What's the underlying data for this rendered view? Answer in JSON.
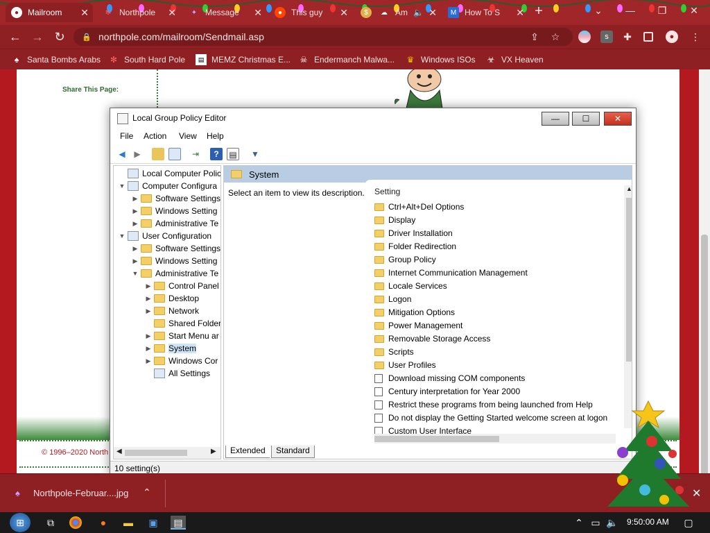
{
  "browser": {
    "tabs": [
      {
        "label": "Mailroom",
        "icon": "chrome-icon",
        "active": true
      },
      {
        "label": "Northpole",
        "icon": "snowflake-icon"
      },
      {
        "label": "Message",
        "icon": "star-icon"
      },
      {
        "label": "This guy",
        "icon": "reddit-icon"
      },
      {
        "label": "",
        "icon": "s-icon"
      },
      {
        "label": "Am",
        "icon": "cloud-icon"
      },
      {
        "label": "How To S",
        "icon": "m-icon"
      }
    ],
    "address": "northpole.com/mailroom/Sendmail.asp",
    "bookmarks": [
      "Santa Bombs Arabs",
      "South Hard Pole",
      "MEMZ Christmas E...",
      "Endermanch Malwa...",
      "Windows ISOs",
      "VX Heaven"
    ]
  },
  "page": {
    "share_label": "Share This Page:",
    "copyright": "© 1996–2020 North"
  },
  "dialog": {
    "title": "Local Group Policy Editor",
    "window_buttons": {
      "minimize": "—",
      "maximize": "☐",
      "close": "✕"
    },
    "menu": [
      "File",
      "Action",
      "View",
      "Help"
    ],
    "tree": [
      {
        "label": "Local Computer Policy",
        "indent": 0,
        "arrow": "",
        "icon": "policy"
      },
      {
        "label": "Computer Configura",
        "indent": 0,
        "arrow": "down",
        "icon": "computer"
      },
      {
        "label": "Software Settings",
        "indent": 1,
        "arrow": "right",
        "icon": "folder"
      },
      {
        "label": "Windows Setting",
        "indent": 1,
        "arrow": "right",
        "icon": "folder"
      },
      {
        "label": "Administrative Te",
        "indent": 1,
        "arrow": "right",
        "icon": "folder"
      },
      {
        "label": "User Configuration",
        "indent": 0,
        "arrow": "down",
        "icon": "user"
      },
      {
        "label": "Software Settings",
        "indent": 1,
        "arrow": "right",
        "icon": "folder"
      },
      {
        "label": "Windows Setting",
        "indent": 1,
        "arrow": "right",
        "icon": "folder"
      },
      {
        "label": "Administrative Te",
        "indent": 1,
        "arrow": "down",
        "icon": "folder"
      },
      {
        "label": "Control Panel",
        "indent": 2,
        "arrow": "right",
        "icon": "folder"
      },
      {
        "label": "Desktop",
        "indent": 2,
        "arrow": "right",
        "icon": "folder"
      },
      {
        "label": "Network",
        "indent": 2,
        "arrow": "right",
        "icon": "folder"
      },
      {
        "label": "Shared Folder",
        "indent": 2,
        "arrow": "",
        "icon": "folder"
      },
      {
        "label": "Start Menu ar",
        "indent": 2,
        "arrow": "right",
        "icon": "folder"
      },
      {
        "label": "System",
        "indent": 2,
        "arrow": "right",
        "icon": "folder",
        "selected": true
      },
      {
        "label": "Windows Cor",
        "indent": 2,
        "arrow": "right",
        "icon": "folder"
      },
      {
        "label": "All Settings",
        "indent": 2,
        "arrow": "",
        "icon": "settings"
      }
    ],
    "pane_title": "System",
    "description": "Select an item to view its description.",
    "list_header": "Setting",
    "settings": [
      {
        "label": "Ctrl+Alt+Del Options",
        "type": "folder"
      },
      {
        "label": "Display",
        "type": "folder"
      },
      {
        "label": "Driver Installation",
        "type": "folder"
      },
      {
        "label": "Folder Redirection",
        "type": "folder"
      },
      {
        "label": "Group Policy",
        "type": "folder"
      },
      {
        "label": "Internet Communication Management",
        "type": "folder"
      },
      {
        "label": "Locale Services",
        "type": "folder"
      },
      {
        "label": "Logon",
        "type": "folder"
      },
      {
        "label": "Mitigation Options",
        "type": "folder"
      },
      {
        "label": "Power Management",
        "type": "folder"
      },
      {
        "label": "Removable Storage Access",
        "type": "folder"
      },
      {
        "label": "Scripts",
        "type": "folder"
      },
      {
        "label": "User Profiles",
        "type": "folder"
      },
      {
        "label": "Download missing COM components",
        "type": "policy"
      },
      {
        "label": "Century interpretation for Year 2000",
        "type": "policy"
      },
      {
        "label": "Restrict these programs from being launched from Help",
        "type": "policy"
      },
      {
        "label": "Do not display the Getting Started welcome screen at logon",
        "type": "policy"
      },
      {
        "label": "Custom User Interface",
        "type": "policy"
      }
    ],
    "view_tabs": [
      "Extended",
      "Standard"
    ],
    "status": "10 setting(s)"
  },
  "download": {
    "file": "Northpole-Februar....jpg"
  },
  "taskbar": {
    "clock": "9:50:00 AM"
  },
  "colors": {
    "chrome_red": "#8e1f22",
    "page_red": "#b4191f",
    "selection": "#cce4f7"
  }
}
